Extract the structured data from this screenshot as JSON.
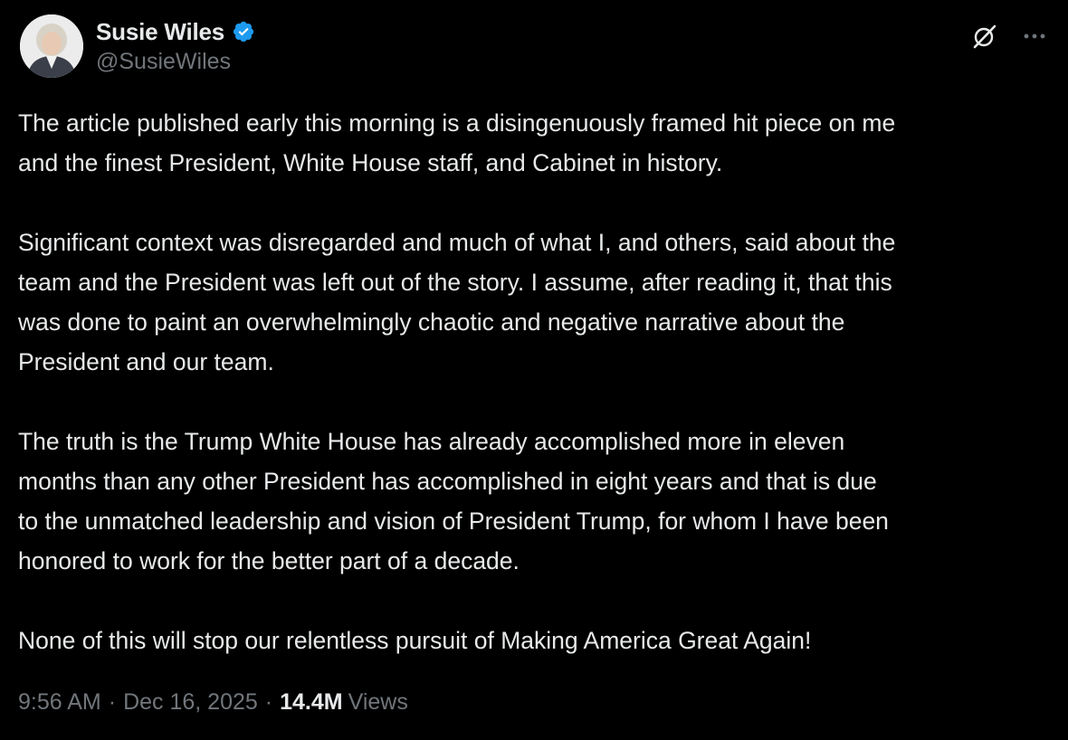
{
  "author": {
    "display_name": "Susie Wiles",
    "handle": "@SusieWiles",
    "verified": true,
    "verified_color": "#1d9bf0"
  },
  "icons": {
    "grok": "grok-icon",
    "more": "more-icon"
  },
  "tweet": {
    "paragraphs": [
      "The article published early this morning is a disingenuously framed hit piece on me\nand the finest President, White House staff, and Cabinet in history.",
      "Significant context was disregarded and much of what I, and others, said about the\nteam and the President was left out of the story. I assume, after reading it, that this\nwas done to paint an overwhelmingly chaotic and negative narrative about the\nPresident and our team.",
      "The truth is the Trump White House has already accomplished more in eleven\nmonths than any other President has accomplished in eight years and that is due\nto the unmatched leadership and vision of President Trump, for whom I have been\nhonored to work for the better part of a decade.",
      "None of this will stop our relentless pursuit of Making America Great Again!"
    ]
  },
  "meta": {
    "time": "9:56 AM",
    "separator": "·",
    "date": "Dec 16, 2025",
    "views_count": "14.4M",
    "views_label": "Views"
  },
  "colors": {
    "background": "#000000",
    "text_primary": "#e7e9ea",
    "text_secondary": "#71767b"
  }
}
